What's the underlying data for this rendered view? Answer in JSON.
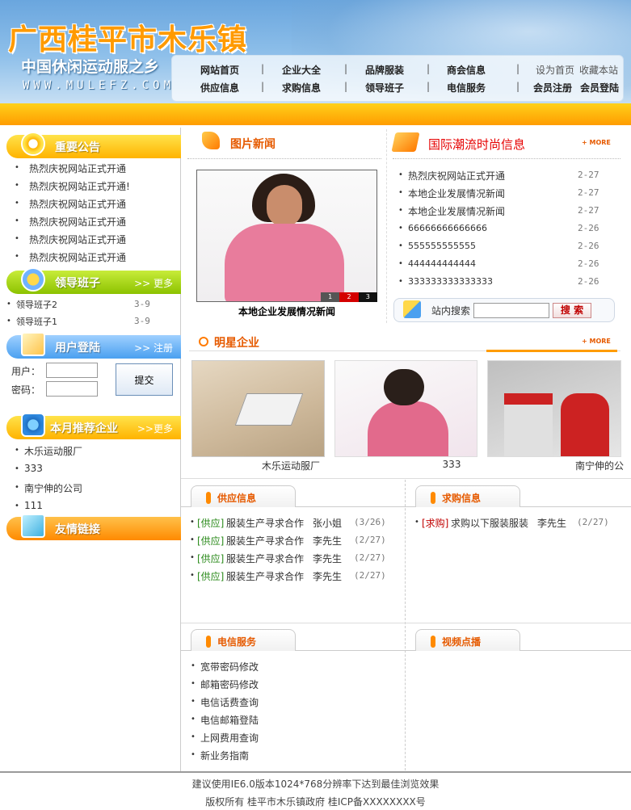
{
  "header": {
    "site_title": "广西桂平市木乐镇",
    "slogan": "中国休闲运动服之乡",
    "domain": "WWW.MULEFZ.COM",
    "nav_row1": [
      "网站首页",
      "企业大全",
      "品牌服装",
      "商会信息"
    ],
    "nav_row2": [
      "供应信息",
      "求购信息",
      "领导班子",
      "电信服务"
    ],
    "nav_sep": "|",
    "set_home": "设为首页",
    "bookmark": "收藏本站",
    "register": "会员注册",
    "login": "会员登陆"
  },
  "announcements": {
    "title": "重要公告",
    "items": [
      "热烈庆祝网站正式开通",
      "热烈庆祝网站正式开通!",
      "热烈庆祝网站正式开通",
      "热烈庆祝网站正式开通",
      "热烈庆祝网站正式开通",
      "热烈庆祝网站正式开通"
    ]
  },
  "leadership": {
    "title": "领导班子",
    "more": ">> 更多",
    "items": [
      {
        "name": "领导班子2",
        "date": "3-9"
      },
      {
        "name": "领导班子1",
        "date": "3-9"
      }
    ]
  },
  "login": {
    "title": "用户登陆",
    "register": ">> 注册",
    "user_label": "用户：",
    "pass_label": "密码：",
    "submit": "提交"
  },
  "recommended": {
    "title": "本月推荐企业",
    "more": ">>更多",
    "items": [
      "木乐运动服厂",
      "333",
      "南宁伸的公司",
      "111"
    ]
  },
  "links": {
    "title": "友情链接"
  },
  "photo_news": {
    "title": "图片新闻",
    "caption": "本地企业发展情况新闻",
    "pages": [
      "1",
      "2",
      "3"
    ]
  },
  "fashion": {
    "title": "国际潮流时尚信息",
    "more": "+ MORE",
    "items": [
      {
        "text": "热烈庆祝网站正式开通",
        "date": "2-27"
      },
      {
        "text": "本地企业发展情况新闻",
        "date": "2-27"
      },
      {
        "text": "本地企业发展情况新闻",
        "date": "2-27"
      },
      {
        "text": "66666666666666",
        "date": "2-26"
      },
      {
        "text": "555555555555",
        "date": "2-26"
      },
      {
        "text": "444444444444",
        "date": "2-26"
      },
      {
        "text": "333333333333333",
        "date": "2-26"
      }
    ]
  },
  "search": {
    "label": "站内搜索",
    "button": "搜 索"
  },
  "star": {
    "title": "明星企业",
    "more": "+ MORE",
    "items": [
      "木乐运动服厂",
      "333",
      "南宁伸的公"
    ]
  },
  "supply": {
    "title": "供应信息",
    "items": [
      {
        "tag": "[供应]",
        "text": "服装生产寻求合作",
        "person": "张小姐",
        "date": "(3/26)"
      },
      {
        "tag": "[供应]",
        "text": "服装生产寻求合作",
        "person": "李先生",
        "date": "(2/27)"
      },
      {
        "tag": "[供应]",
        "text": "服装生产寻求合作",
        "person": "李先生",
        "date": "(2/27)"
      },
      {
        "tag": "[供应]",
        "text": "服装生产寻求合作",
        "person": "李先生",
        "date": "(2/27)"
      }
    ]
  },
  "purchase": {
    "title": "求购信息",
    "items": [
      {
        "tag": "[求购]",
        "text": "求购以下服装服装",
        "person": "李先生",
        "date": "(2/27)"
      }
    ]
  },
  "telecom": {
    "title": "电信服务",
    "items": [
      "宽带密码修改",
      "邮箱密码修改",
      "电信话费查询",
      "电信邮箱登陆",
      "上网费用查询",
      "新业务指南"
    ]
  },
  "video": {
    "title": "视频点播"
  },
  "footer": {
    "line1": "建议使用IE6.0版本1024*768分辨率下达到最佳浏览效果",
    "line2": "版权所有 桂平市木乐镇政府  桂ICP备XXXXXXXX号"
  },
  "colors": {
    "accent": "#ff9c00",
    "title_orange": "#e65a00",
    "nav_blue": "#6aa6de"
  },
  "icons": [
    "clock-icon",
    "chat-icon",
    "pen-icon",
    "tv-icon",
    "book-icon",
    "cube-icon"
  ]
}
